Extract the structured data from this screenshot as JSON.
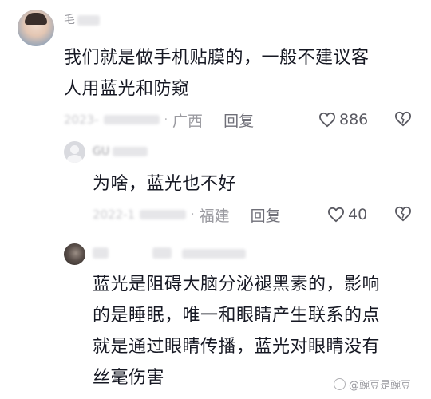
{
  "comments": [
    {
      "user": "毛",
      "text_lines": [
        "我们就是做手机贴膜的，一般不建议客",
        "人用蓝光和防窥"
      ],
      "date": "2023-",
      "location": "广西",
      "reply_label": "回复",
      "likes": "886"
    },
    {
      "user": "GU",
      "text_lines": [
        "为啥，蓝光也不好"
      ],
      "date": "2022-1",
      "location": "福建",
      "reply_label": "回复",
      "likes": "40"
    },
    {
      "user": "",
      "text_lines": [
        "蓝光是阻碍大脑分泌褪黑素的，影响",
        "的是睡眠，唯一和眼睛产生联系的点",
        "就是通过眼睛传播，蓝光对眼睛没有",
        "丝毫伤害"
      ]
    }
  ],
  "watermark": "@豌豆是豌豆"
}
